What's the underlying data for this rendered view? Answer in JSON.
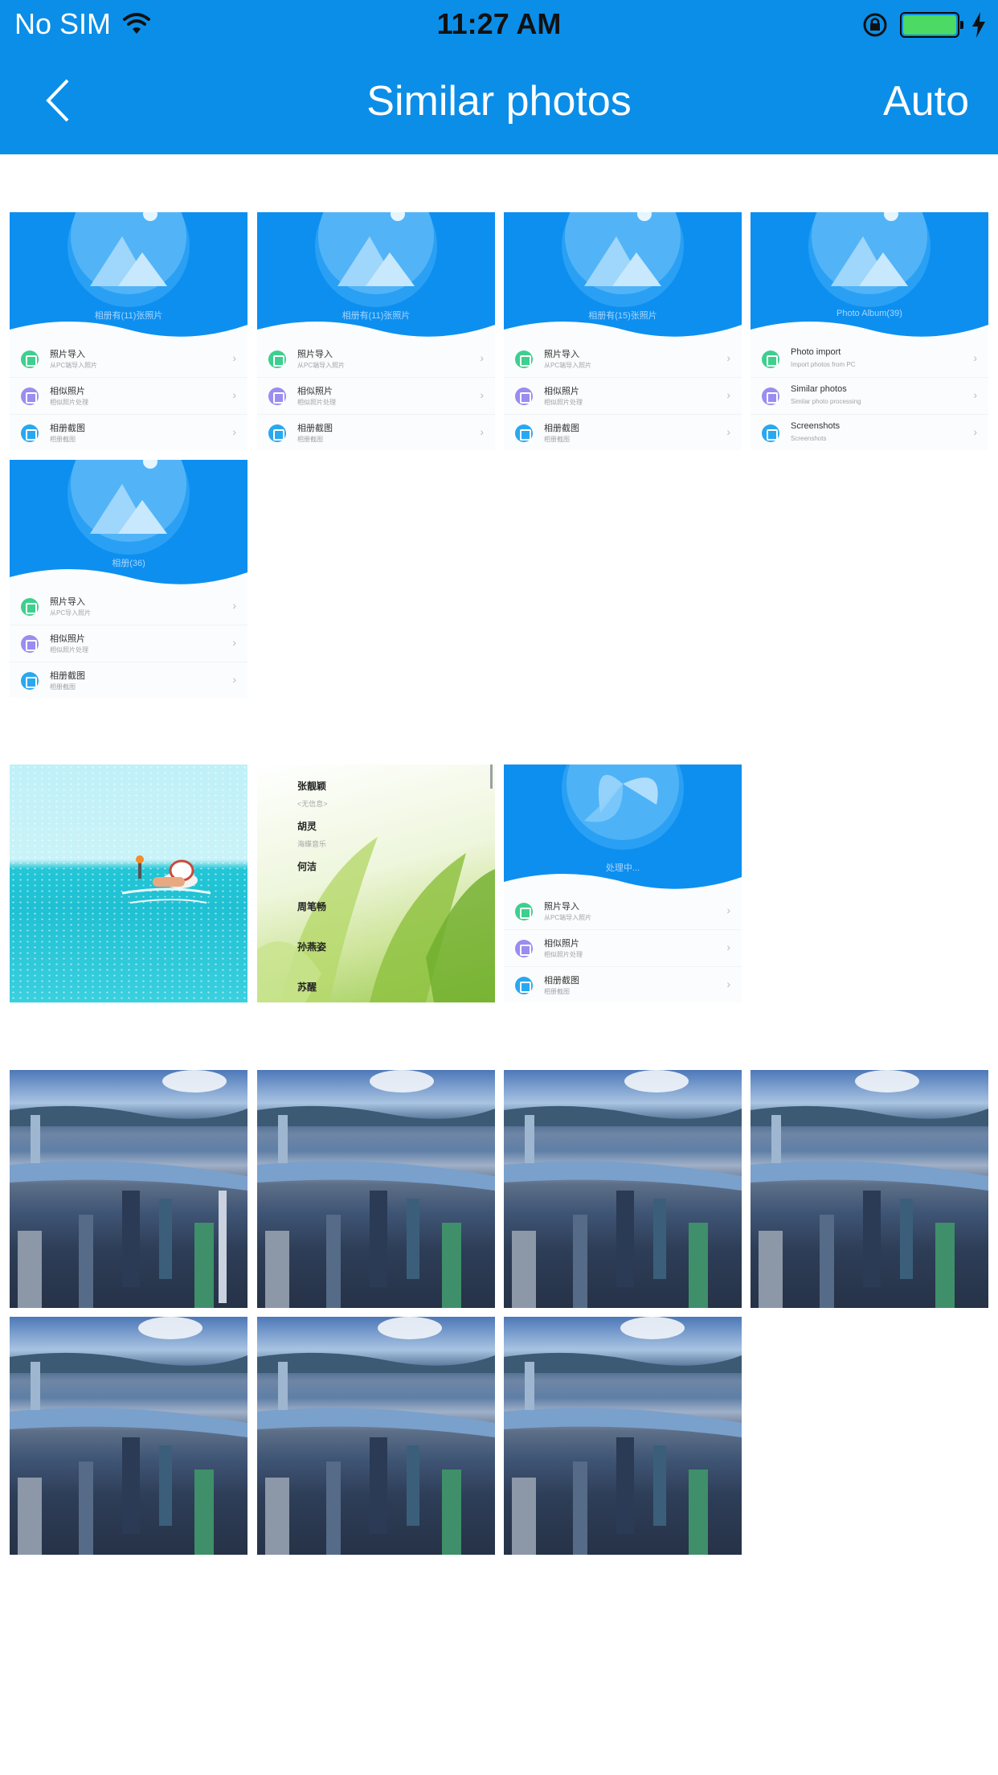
{
  "status_bar": {
    "carrier": "No SIM",
    "time": "11:27 AM"
  },
  "nav": {
    "title": "Similar photos",
    "right_action": "Auto"
  },
  "app_thumbs": [
    {
      "caption": "相册有(11)张照片",
      "rows": [
        {
          "title": "照片导入",
          "subtitle": "从PC端导入照片"
        },
        {
          "title": "相似照片",
          "subtitle": "相似照片处理"
        },
        {
          "title": "相册截图",
          "subtitle": "相册截图"
        }
      ]
    },
    {
      "caption": "相册有(11)张照片",
      "rows": [
        {
          "title": "照片导入",
          "subtitle": "从PC端导入照片"
        },
        {
          "title": "相似照片",
          "subtitle": "相似照片处理"
        },
        {
          "title": "相册截图",
          "subtitle": "相册截图"
        }
      ]
    },
    {
      "caption": "相册有(15)张照片",
      "rows": [
        {
          "title": "照片导入",
          "subtitle": "从PC端导入照片"
        },
        {
          "title": "相似照片",
          "subtitle": "相似照片处理"
        },
        {
          "title": "相册截图",
          "subtitle": "相册截图"
        }
      ]
    },
    {
      "caption": "Photo Album(39)",
      "rows": [
        {
          "title": "Photo import",
          "subtitle": "Import photos from PC"
        },
        {
          "title": "Similar photos",
          "subtitle": "Similar photo processing"
        },
        {
          "title": "Screenshots",
          "subtitle": "Screenshots"
        }
      ]
    },
    {
      "caption": "相册(36)",
      "rows": [
        {
          "title": "照片导入",
          "subtitle": "从PC导入照片"
        },
        {
          "title": "相似照片",
          "subtitle": "相似照片处理"
        },
        {
          "title": "相册截图",
          "subtitle": "相册截图"
        }
      ]
    },
    {
      "caption": "处理中...",
      "rows": [
        {
          "title": "照片导入",
          "subtitle": "从PC端导入照片"
        },
        {
          "title": "相似照片",
          "subtitle": "相似照片处理"
        },
        {
          "title": "相册截图",
          "subtitle": "相册截图"
        }
      ]
    }
  ],
  "leaves_thumb": {
    "names": [
      "张靓颖",
      "胡灵",
      "何洁",
      "周笔畅",
      "孙燕姿",
      "苏醒"
    ],
    "subs": [
      "<无信息>",
      "海蝶音乐"
    ]
  },
  "colors": {
    "nav_blue": "#0b8ee8",
    "battery_green": "#4cd964",
    "icon_green": "#3ecf8e",
    "icon_purple": "#9a8cf0",
    "icon_blue": "#29a8f0"
  }
}
